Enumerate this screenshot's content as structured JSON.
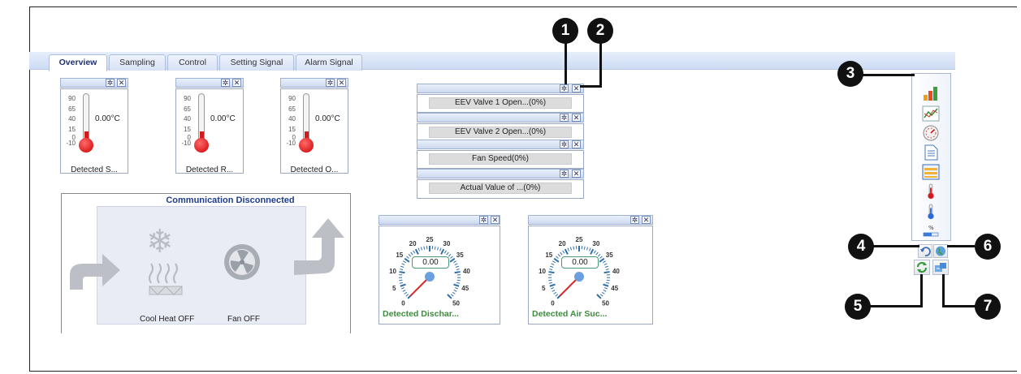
{
  "tabs": [
    "Overview",
    "Sampling",
    "Control",
    "Setting Signal",
    "Alarm Signal"
  ],
  "thermometers": [
    {
      "scale": [
        "90",
        "65",
        "40",
        "15",
        "0",
        "-10"
      ],
      "value": "0.00°C",
      "name": "Detected S..."
    },
    {
      "scale": [
        "90",
        "65",
        "40",
        "15",
        "0",
        "-10"
      ],
      "value": "0.00°C",
      "name": "Detected R..."
    },
    {
      "scale": [
        "90",
        "65",
        "40",
        "15",
        "0",
        "-10"
      ],
      "value": "0.00°C",
      "name": "Detected O..."
    }
  ],
  "bars": [
    {
      "label": "EEV Valve 1 Open...(0%)",
      "value_pct": 0
    },
    {
      "label": "EEV Valve 2 Open...(0%)",
      "value_pct": 0
    },
    {
      "label": "Fan Speed(0%)",
      "value_pct": 0
    },
    {
      "label": "Actual Value of ...(0%)",
      "value_pct": 0
    }
  ],
  "communication": {
    "title": "Communication Disconnected",
    "cool_heat_label": "Cool Heat OFF",
    "fan_label": "Fan OFF"
  },
  "gauges": [
    {
      "value": "0.00",
      "name": "Detected Dischar...",
      "ticks": [
        "0",
        "5",
        "10",
        "15",
        "20",
        "25",
        "30",
        "35",
        "40",
        "45",
        "50"
      ]
    },
    {
      "value": "0.00",
      "name": "Detected Air Suc...",
      "ticks": [
        "0",
        "5",
        "10",
        "15",
        "20",
        "25",
        "30",
        "35",
        "40",
        "45",
        "50"
      ]
    }
  ],
  "toolbox_icons": [
    "bar-chart-icon",
    "line-chart-icon",
    "gauge-icon",
    "document-icon",
    "list-icon",
    "red-thermometer-icon",
    "blue-thermometer-icon",
    "percent-bar-icon"
  ],
  "small_buttons": [
    "undo-icon",
    "globe-icon",
    "refresh-icon",
    "export-icon"
  ],
  "callouts": [
    "1",
    "2",
    "3",
    "4",
    "5",
    "6",
    "7"
  ],
  "colors": {
    "accent": "#1e3c8c",
    "alarm_red": "#d31b1b",
    "gauge_green": "#3b8c3b",
    "tab_blue": "#cddcf4"
  }
}
